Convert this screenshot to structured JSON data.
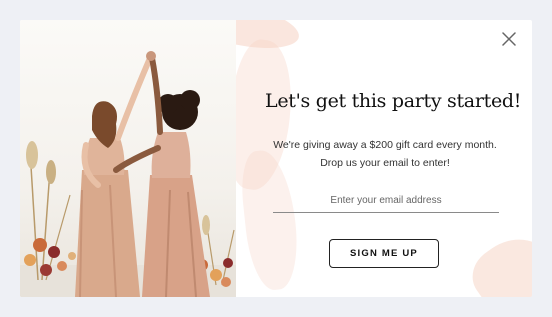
{
  "popup": {
    "headline": "Let's get this party started!",
    "subtext": "We're giving away a $200 gift card every month. Drop us your email to enter!",
    "email_placeholder": "Enter your email address",
    "cta_label": "SIGN ME UP",
    "close_icon": "close-icon"
  },
  "colors": {
    "page_bg": "#eef0f5",
    "modal_bg": "#ffffff",
    "brush_accent": "#f6d2c2",
    "text": "#111111",
    "button_border": "#222222"
  }
}
